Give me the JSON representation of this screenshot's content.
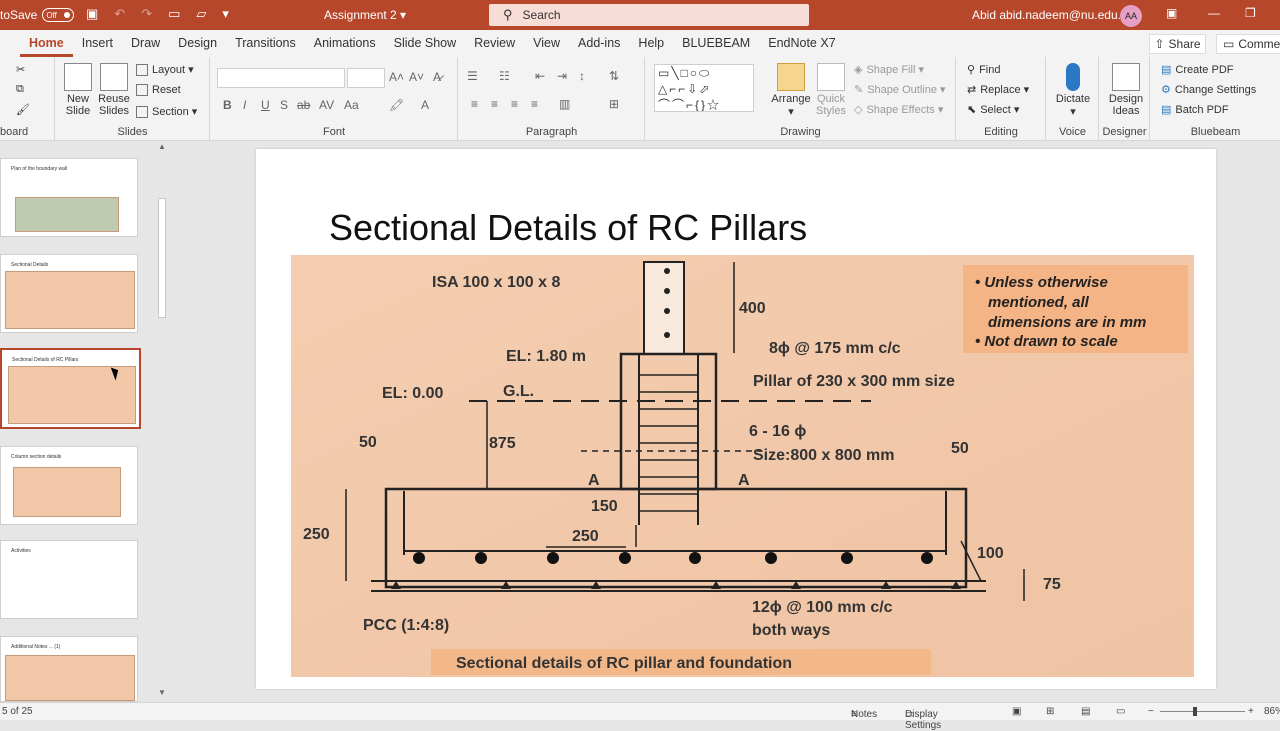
{
  "titlebar": {
    "autosave_label": "toSave",
    "autosave_state": "Off",
    "doc_title": "Assignment 2",
    "search_placeholder": "Search",
    "user": "Abid abid.nadeem@nu.edu.kz",
    "avatar": "AA"
  },
  "tabs": [
    "Home",
    "Insert",
    "Draw",
    "Design",
    "Transitions",
    "Animations",
    "Slide Show",
    "Review",
    "View",
    "Add-ins",
    "Help",
    "BLUEBEAM",
    "EndNote X7"
  ],
  "active_tab": "Home",
  "share_label": "Share",
  "comments_label": "Commer",
  "ribbon": {
    "clipboard_label": "board",
    "slides": {
      "new_slide": "New",
      "new_slide2": "Slide",
      "reuse": "Reuse",
      "reuse2": "Slides",
      "layout": "Layout",
      "reset": "Reset",
      "section": "Section",
      "label": "Slides"
    },
    "font_label": "Font",
    "paragraph_label": "Paragraph",
    "drawing": {
      "arrange": "Arrange",
      "quick": "Quick",
      "quick2": "Styles",
      "fill": "Shape Fill",
      "outline": "Shape Outline",
      "effects": "Shape Effects",
      "label": "Drawing",
      "shapes_glyphs": "▭╲□○⬭\n△⌐⌐⇩⬀\n⌒⌒⌐{}☆"
    },
    "editing": {
      "find": "Find",
      "replace": "Replace",
      "select": "Select",
      "label": "Editing"
    },
    "voice": {
      "dictate": "Dictate",
      "label": "Voice"
    },
    "designer": {
      "ideas": "Design",
      "ideas2": "Ideas",
      "label": "Designer"
    },
    "bluebeam": {
      "create": "Create PDF",
      "change": "Change Settings",
      "batch": "Batch PDF",
      "label": "Bluebeam"
    }
  },
  "thumbnails": [
    {
      "title": "Plan of the boundary wall"
    },
    {
      "title": "Sectional Details"
    },
    {
      "title": "Sectional Details of RC Pillars"
    },
    {
      "title": "Column section details"
    },
    {
      "title": "Activities"
    },
    {
      "title": "Additional Notes ... (1)"
    }
  ],
  "slide": {
    "title": "Sectional Details of RC Pillars",
    "labels": {
      "isa": "ISA 100 x 100 x 8",
      "h400": "400",
      "el180": "EL: 1.80 m",
      "bar8": "8ϕ @ 175 mm c/c",
      "pillar": "Pillar of 230 x 300 mm size",
      "el000": "EL: 0.00",
      "gl": "G.L.",
      "h875": "875",
      "bars16": "6 - 16 ϕ",
      "size": "Size:800 x 800 mm",
      "a1": "A",
      "a2": "A",
      "c50a": "50",
      "c50b": "50",
      "h250": "250",
      "h150": "150",
      "w250": "250",
      "c100": "100",
      "c75": "75",
      "bar12": "12ϕ @ 100 mm c/c",
      "both": "both ways",
      "pcc": "PCC (1:4:8)",
      "caption": "Sectional details of  RC pillar and foundation",
      "note1": "• Unless otherwise",
      "note2": "mentioned, all",
      "note3": "dimensions are in mm",
      "note4": "• Not drawn to scale"
    }
  },
  "status": {
    "slide_count": "5 of 25",
    "notes": "Notes",
    "display": "Display Settings",
    "zoom": "86%"
  }
}
